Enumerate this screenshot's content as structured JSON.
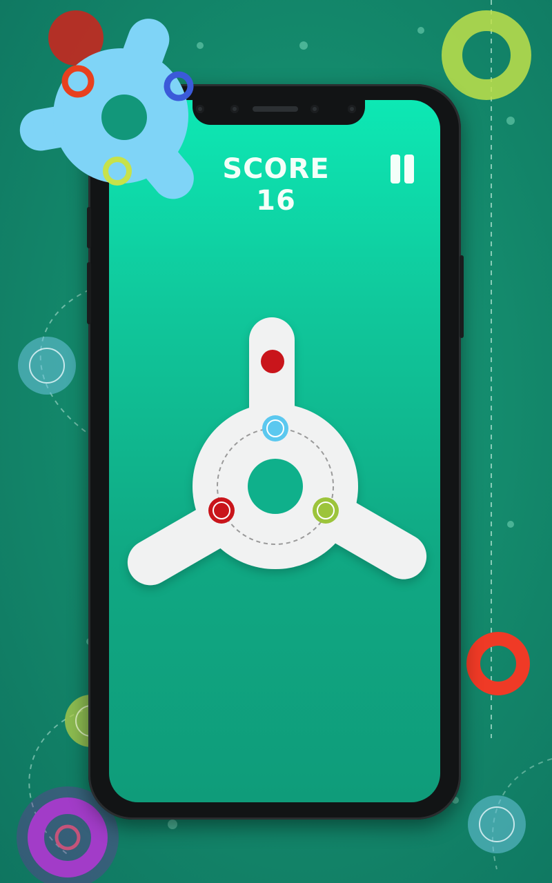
{
  "game": {
    "score_text": "SCORE 16",
    "score": 16
  },
  "colors": {
    "background": "#13876a",
    "screen_top": "#0de8b4",
    "screen_bottom": "#0f9c7a",
    "spinner": "#f1f2f2",
    "red": "#c9151b",
    "blue": "#5bc8ef",
    "green": "#9cc43b",
    "purple": "#a23cc8",
    "promo_spinner": "#7fd4f7"
  },
  "icons": {
    "pause": "pause-icon"
  }
}
